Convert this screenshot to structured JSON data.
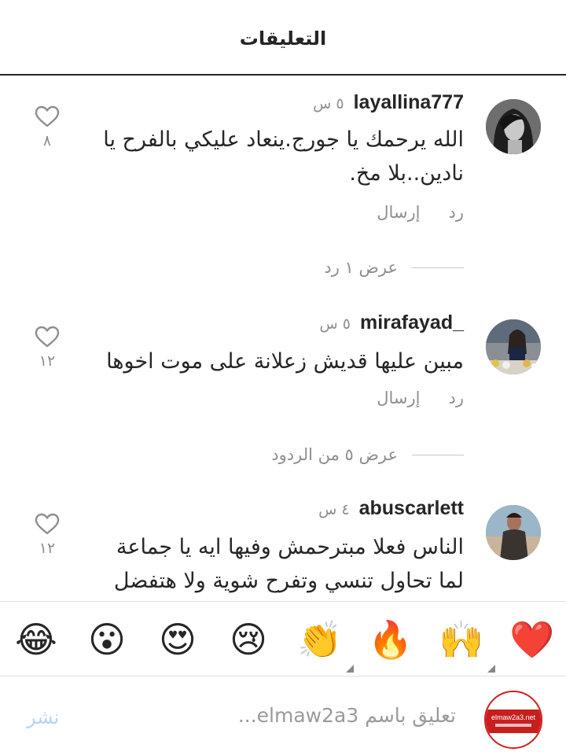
{
  "header": {
    "title": "التعليقات"
  },
  "comments": [
    {
      "username": "layallina777",
      "time": "٥ س",
      "text": "الله يرحمك يا جورج.ينعاد عليكي بالفرح يا نادين..بلا مخ.",
      "like_count": "٨",
      "reply_label": "رد",
      "send_label": "إرسال",
      "view_replies": "عرض ١ رد"
    },
    {
      "username": "_mirafayad",
      "time": "٥ س",
      "text": "مبين عليها قديش زعلانة على موت اخوها",
      "like_count": "١٢",
      "reply_label": "رد",
      "send_label": "إرسال",
      "view_replies": "عرض ٥ من الردود"
    },
    {
      "username": "abuscarlett",
      "time": "٤ س",
      "text": "الناس فعلا مبترحمش وفيها ايه يا جماعة لما تحاول تنسي وتفرح شوية ولا هتفضل",
      "like_count": "١٢"
    }
  ],
  "emoji_bar": [
    "😂",
    "😮",
    "😍",
    "😢",
    "👏",
    "🔥",
    "🙌",
    "❤️"
  ],
  "compose": {
    "placeholder": "تعليق باسم elmaw2a3...",
    "post_label": "نشر",
    "avatar_text": "elmaw2a3.net"
  },
  "colors": {
    "accent": "#3897f0",
    "muted": "#8e8e8e",
    "text": "#262626",
    "brand_red": "#cc1f1f"
  }
}
